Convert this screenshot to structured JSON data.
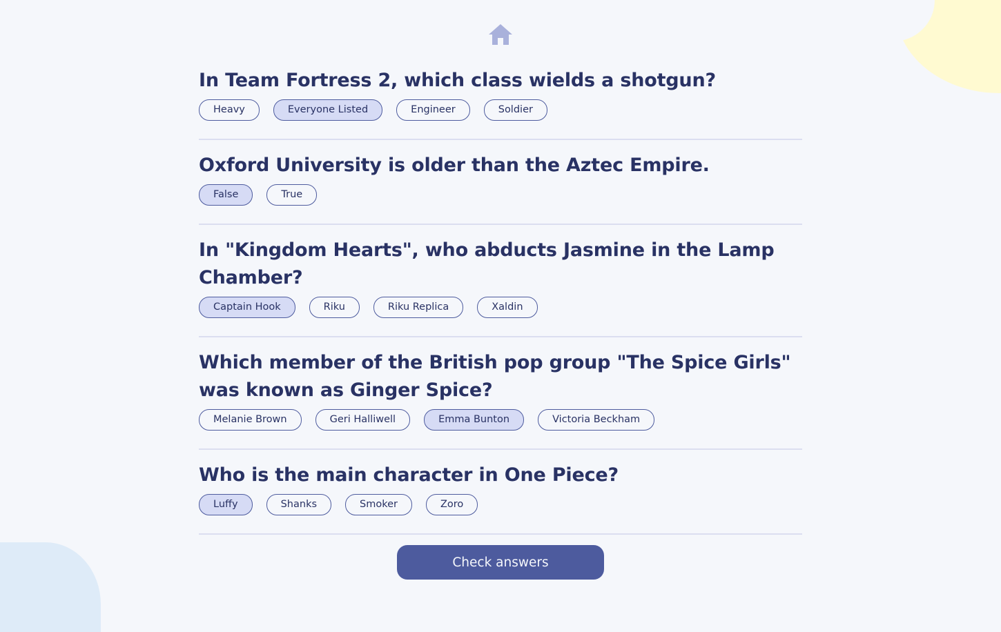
{
  "colors": {
    "background": "#f5f7fb",
    "text": "#293264",
    "accent": "#4d5b9e",
    "selected": "#d6dbf5",
    "divider": "#dbdef0",
    "blob_top": "#fffad1",
    "blob_bottom": "#deebf8"
  },
  "header": {
    "home_icon": "home-icon"
  },
  "questions": [
    {
      "text": "In Team Fortress 2, which class wields a shotgun?",
      "answers": [
        "Heavy",
        "Everyone Listed",
        "Engineer",
        "Soldier"
      ],
      "selected": "Everyone Listed"
    },
    {
      "text": "Oxford University is older than the Aztec Empire.",
      "answers": [
        "False",
        "True"
      ],
      "selected": "False"
    },
    {
      "text": "In \"Kingdom Hearts\", who abducts Jasmine in the Lamp Chamber?",
      "answers": [
        "Captain Hook",
        "Riku",
        "Riku Replica",
        "Xaldin"
      ],
      "selected": "Captain Hook"
    },
    {
      "text": "Which member of the British pop group \"The Spice Girls\" was known as Ginger Spice?",
      "answers": [
        "Melanie Brown",
        "Geri Halliwell",
        "Emma Bunton",
        "Victoria Beckham"
      ],
      "selected": "Emma Bunton"
    },
    {
      "text": "Who is the main character in One Piece?",
      "answers": [
        "Luffy",
        "Shanks",
        "Smoker",
        "Zoro"
      ],
      "selected": "Luffy"
    }
  ],
  "footer": {
    "check_label": "Check answers"
  }
}
